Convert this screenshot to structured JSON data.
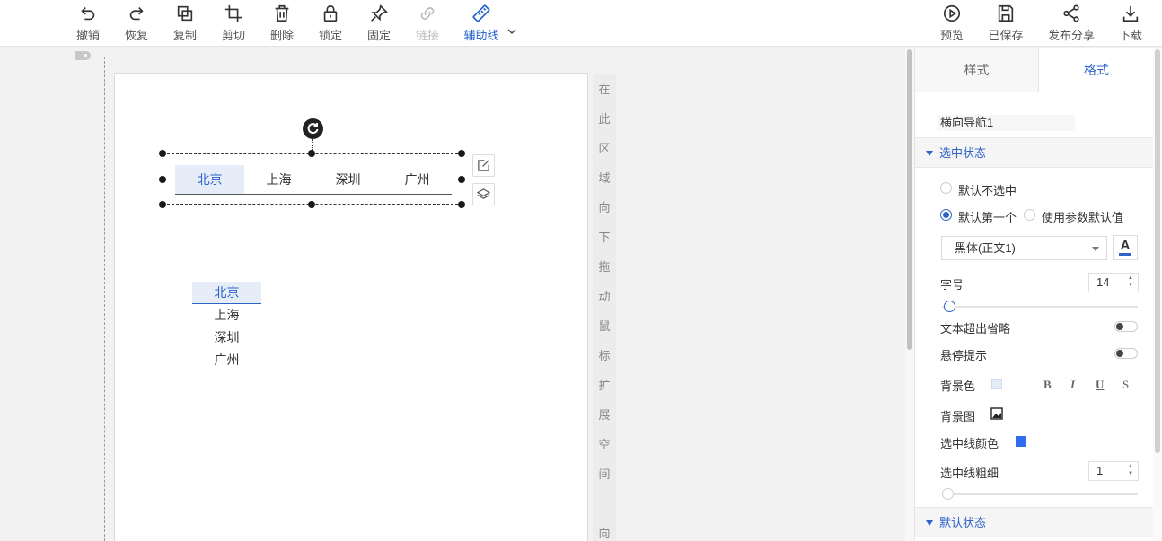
{
  "toolbar": {
    "undo": "撤销",
    "redo": "恢复",
    "copy": "复制",
    "cut": "剪切",
    "delete": "删除",
    "lock": "锁定",
    "pin": "固定",
    "link": "链接",
    "guides": "辅助线",
    "preview": "预览",
    "saved": "已保存",
    "share": "发布分享",
    "download": "下载"
  },
  "canvas": {
    "expand_hint": [
      "在",
      "此",
      "区",
      "域",
      "向",
      "下",
      "拖",
      "动",
      "鼠",
      "标",
      "扩",
      "展",
      "空",
      "间",
      "",
      "向"
    ],
    "horizontal_nav": [
      "北京",
      "上海",
      "深圳",
      "广州"
    ],
    "vertical_nav": [
      "北京",
      "上海",
      "深圳",
      "广州"
    ],
    "selected_index": 0
  },
  "panel": {
    "tabs": [
      "样式",
      "格式"
    ],
    "active_tab": "格式",
    "component_name": "横向导航1",
    "selected_state_title": "选中状态",
    "radio_default_none": "默认不选中",
    "radio_default_first": "默认第一个",
    "radio_param_default": "使用参数默认值",
    "font_family": "黑体(正文1)",
    "font_color_glyph": "A",
    "font_size_label": "字号",
    "font_size": "14",
    "ellipsis_label": "文本超出省略",
    "hover_tip_label": "悬停提示",
    "bg_color_label": "背景色",
    "format_buttons": [
      "B",
      "I",
      "U",
      "S"
    ],
    "bg_image_label": "背景图",
    "sel_line_color_label": "选中线颜色",
    "sel_line_width_label": "选中线粗细",
    "sel_line_width": "1",
    "default_state_title": "默认状态",
    "colors": {
      "accent": "#2e63c8",
      "bg_swatch": "#e6edf9",
      "line_swatch": "#2f6cf0"
    }
  }
}
